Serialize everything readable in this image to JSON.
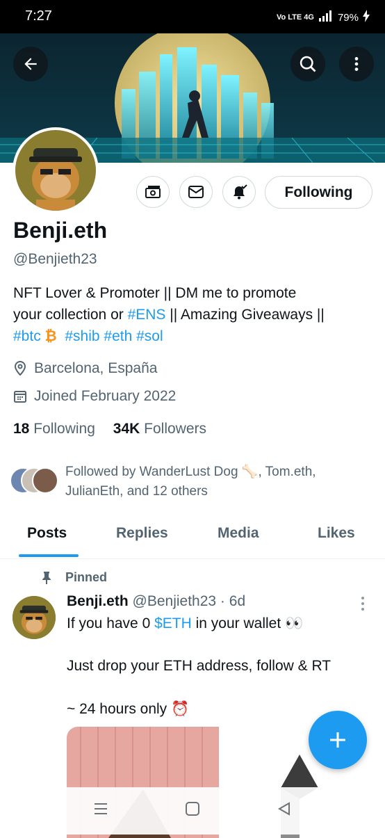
{
  "status_bar": {
    "time": "7:27",
    "network": "Vo LTE 4G",
    "battery": "79%"
  },
  "profile": {
    "name": "Benji.eth",
    "handle": "@Benjieth23",
    "following_button": "Following",
    "bio": {
      "line1": "NFT Lover & Promoter || DM me to promote",
      "line2_a": "your collection or ",
      "line2_link": "#ENS",
      "line2_b": " || Amazing Giveaways ||",
      "tag_btc": "#btc",
      "btc_symbol": "₿",
      "tag_shib": "#shib",
      "tag_eth": "#eth",
      "tag_sol": "#sol"
    },
    "location": "Barcelona, España",
    "joined": "Joined February 2022",
    "following_count": "18",
    "following_label": "Following",
    "followers_count": "34K",
    "followers_label": "Followers",
    "followed_by_line1": "Followed by WanderLust Dog 🦴, Tom.eth,",
    "followed_by_line2": "JulianEth, and 12 others"
  },
  "tabs": [
    "Posts",
    "Replies",
    "Media",
    "Likes"
  ],
  "post": {
    "pinned_label": "Pinned",
    "author": "Benji.eth",
    "handle_time": "@Benjieth23 · 6d",
    "line1_a": "If you have 0 ",
    "line1_link": "$ETH",
    "line1_b": " in your wallet 👀",
    "line2": "Just drop your ETH address, follow & RT",
    "line3": "~ 24 hours only ⏰"
  },
  "colors": {
    "accent": "#1d9bf0",
    "text": "#0f1419",
    "muted": "#536471",
    "btc": "#f7931a"
  }
}
